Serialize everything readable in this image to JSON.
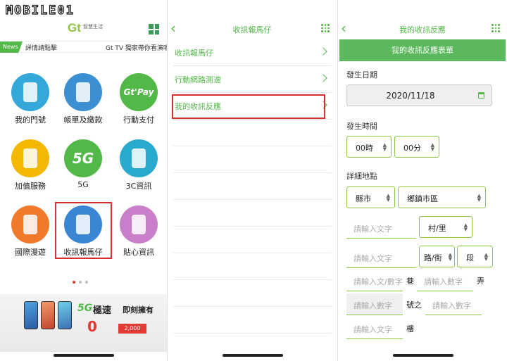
{
  "watermark": "MOBILE01",
  "home": {
    "brand": "Gt",
    "brand_sub": "智慧生活",
    "news_tag": "News",
    "news_text": "詳情請點擊",
    "news_text2": "Gt TV 獨家帶你看演唱",
    "icons": [
      {
        "label": "我的門號",
        "icon": "person-icon",
        "color": "#34a8d8"
      },
      {
        "label": "帳單及繳款",
        "icon": "bill-icon",
        "color": "#3c8fd0"
      },
      {
        "label": "行動支付",
        "icon": "gtpay-icon",
        "color": "#52b848",
        "glyph": "Gt'Pay"
      },
      {
        "label": "加值服務",
        "icon": "money-bag-icon",
        "color": "#f5b800"
      },
      {
        "label": "5G",
        "icon": "5g-icon",
        "color": "#52b848",
        "glyph": "5G"
      },
      {
        "label": "3C資訊",
        "icon": "phone-dollar-icon",
        "color": "#28aacf"
      },
      {
        "label": "國際漫遊",
        "icon": "satellite-icon",
        "color": "#f07a2a"
      },
      {
        "label": "收訊報馬仔",
        "icon": "phone-signal-icon",
        "color": "#3b86d4"
      },
      {
        "label": "貼心資訊",
        "icon": "support-icon",
        "color": "#c97ec9"
      }
    ],
    "banner": {
      "title_5g": "5G",
      "title_fast": "極速",
      "title_now": "即刻擁有",
      "zero": "0",
      "price": "2,000"
    }
  },
  "menu": {
    "title": "收訊報馬仔",
    "items": [
      "收訊報馬仔",
      "行動網路測速",
      "我的收訊反應"
    ]
  },
  "form": {
    "title": "我的收訊反應",
    "bar": "我的收訊反應表單",
    "date_label": "發生日期",
    "date_value": "2020/11/18",
    "time_label": "發生時間",
    "hour": "00時",
    "minute": "00分",
    "location_label": "詳細地點",
    "county": "縣市",
    "district": "鄉鎮市區",
    "placeholder": "請輸入文字",
    "placeholder_num": "請輸入數字",
    "placeholder_textnum": "請輸入文/數字",
    "village": "村/里",
    "road": "路/街",
    "section": "段",
    "lane": "巷",
    "alley": "弄",
    "number_of": "號之",
    "floor": "樓"
  }
}
